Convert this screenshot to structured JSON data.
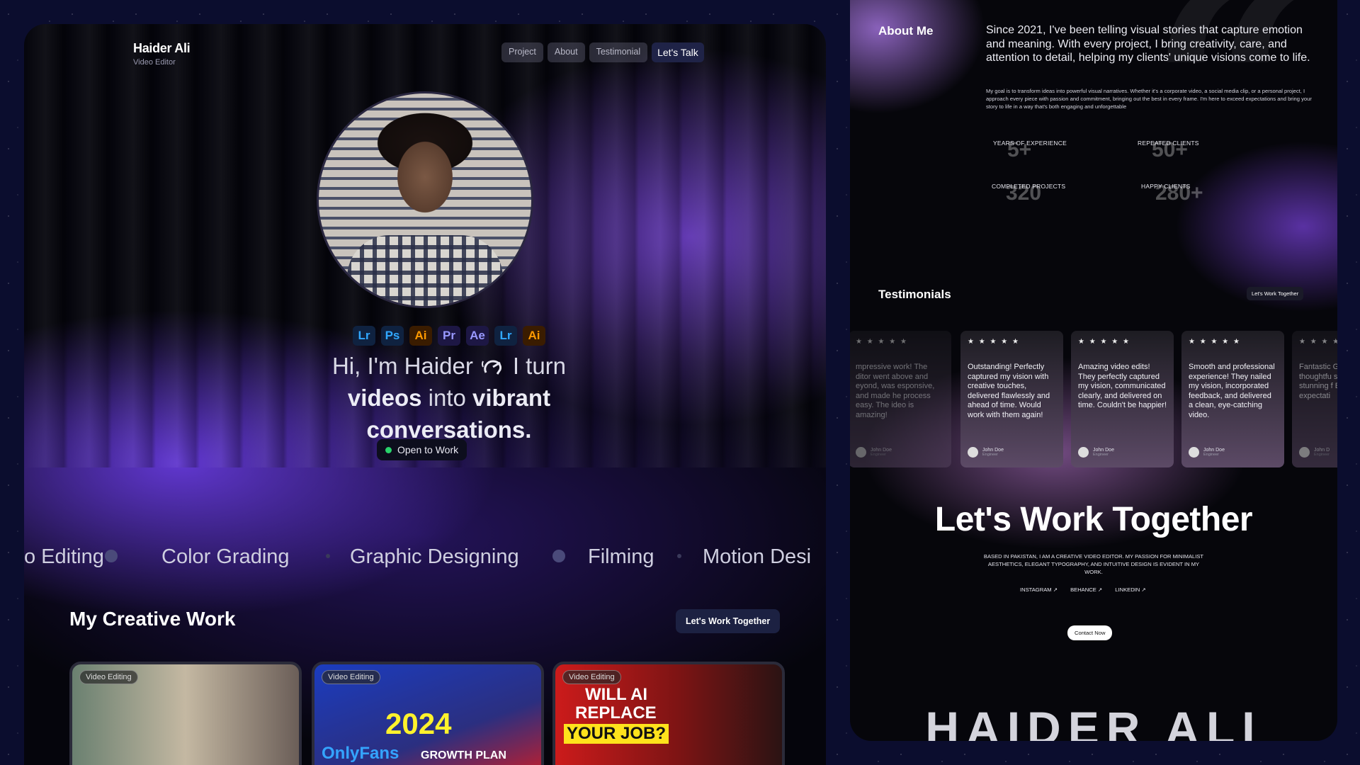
{
  "portfolio": {
    "brand": {
      "name": "Haider Ali",
      "role": "Video Editor"
    },
    "nav": [
      "Project",
      "About",
      "Testimonial",
      "Let's Talk"
    ],
    "tools": [
      {
        "label": "Lr",
        "color": "#31a8ff",
        "bg": "#0f2240"
      },
      {
        "label": "Ps",
        "color": "#31a8ff",
        "bg": "#0f2240"
      },
      {
        "label": "Ai",
        "color": "#ff9a00",
        "bg": "#3a1c00"
      },
      {
        "label": "Pr",
        "color": "#9999ff",
        "bg": "#1d1744"
      },
      {
        "label": "Ae",
        "color": "#9999ff",
        "bg": "#1d1744"
      },
      {
        "label": "Lr",
        "color": "#31a8ff",
        "bg": "#0f2240"
      },
      {
        "label": "Ai",
        "color": "#ff9a00",
        "bg": "#3a1c00"
      }
    ],
    "headline": {
      "line1a": "Hi, I'm Haider",
      "line1b": "I turn",
      "w1": "videos",
      "w2": "into",
      "w3": "vibrant",
      "w4": "conversations."
    },
    "open_status": "Open to Work",
    "skills": [
      "o Editing",
      "Color Grading",
      "Graphic Designing",
      "Filming",
      "Motion Desi"
    ],
    "work_section": {
      "title": "My Creative Work",
      "button": "Let's Work Together"
    },
    "cards": [
      {
        "tag": "Video Editing",
        "overlay": []
      },
      {
        "tag": "Video Editing",
        "overlay": [
          "2024",
          "OnlyFans",
          "GROWTH PLAN"
        ]
      },
      {
        "tag": "Video Editing",
        "overlay": [
          "WILL AI",
          "REPLACE",
          "YOUR JOB?"
        ]
      }
    ]
  },
  "about": {
    "title": "About Me",
    "lead": "Since 2021, I've been telling visual stories that capture emotion and meaning. With every project, I bring creativity, care, and attention to detail, helping my clients' unique visions come to life.",
    "small": "My goal is to transform ideas into powerful visual narratives. Whether it's a corporate video, a social media clip, or a personal project, I approach every piece with passion and commitment, bringing out the best in every frame. I'm here to exceed expectations and bring your story to life in a way that's both engaging and unforgettable",
    "stats": [
      {
        "label": "YEARS OF EXPERIENCE",
        "value": "5+"
      },
      {
        "label": "REPEATED CLIENTS",
        "value": "50+"
      },
      {
        "label": "COMPLETED PROJECTS",
        "value": "320"
      },
      {
        "label": "HAPPY CLIENTS",
        "value": "280+"
      }
    ]
  },
  "testimonials": {
    "title": "Testimonials",
    "button": "Let's Work Together",
    "stars": "★ ★ ★ ★ ★",
    "items": [
      {
        "text": "mpressive work! The ditor went above and eyond, was esponsive, and made he process easy. The ideo is amazing!",
        "name": "John Doe",
        "role": "Engineer"
      },
      {
        "text": "Outstanding! Perfectly captured my vision with creative touches, delivered flawlessly and ahead of time. Would work with them again!",
        "name": "John Doe",
        "role": "Engineer"
      },
      {
        "text": "Amazing video edits! They perfectly captured my vision, communicated clearly, and delivered on time. Couldn't be happier!",
        "name": "John Doe",
        "role": "Engineer"
      },
      {
        "text": "Smooth and professional experience! They nailed my vision, incorporated feedback, and delivered a clean, eye-catching video.",
        "name": "John Doe",
        "role": "Engineer"
      },
      {
        "text": "Fantastic Great co thoughtfu suggestic stunning f Exceedec expectati",
        "name": "John D",
        "role": "Engineer"
      }
    ]
  },
  "contact": {
    "title": "Let's Work Together",
    "based": "BASED IN PAKISTAN, I AM A CREATIVE VIDEO EDITOR. MY PASSION FOR MINIMALIST AESTHETICS, ELEGANT TYPOGRAPHY, AND INTUITIVE DESIGN IS EVIDENT IN MY WORK.",
    "links": [
      "INSTAGRAM ↗",
      "BEHANCE ↗",
      "LINKEDIN ↗"
    ],
    "button": "Contact Now",
    "footer_name": "HAIDER ALI"
  }
}
